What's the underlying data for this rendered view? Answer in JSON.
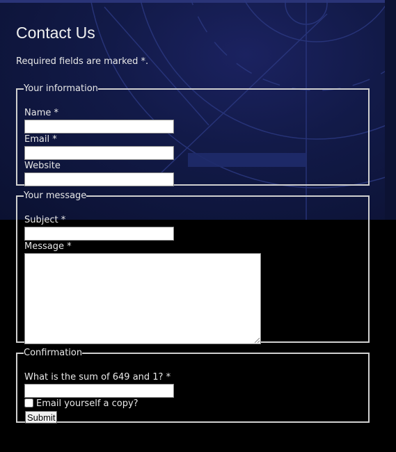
{
  "page": {
    "title": "Contact Us",
    "intro": "Required fields are marked *."
  },
  "your_information": {
    "legend": "Your information",
    "name_label": "Name *",
    "name_value": "",
    "email_label": "Email *",
    "email_value": "",
    "website_label": "Website",
    "website_value": ""
  },
  "your_message": {
    "legend": "Your message",
    "subject_label": "Subject *",
    "subject_value": "",
    "message_label": "Message *",
    "message_value": ""
  },
  "confirmation": {
    "legend": "Confirmation",
    "captcha_label": "What is the sum of 649 and 1? *",
    "captcha_value": "",
    "copy_label": "Email yourself a copy?",
    "copy_checked": false,
    "submit_label": "Submit"
  },
  "colors": {
    "background_top": "#121a48",
    "background_bottom": "#000000",
    "text": "#e8e8e8",
    "border": "#d0d0d0"
  }
}
